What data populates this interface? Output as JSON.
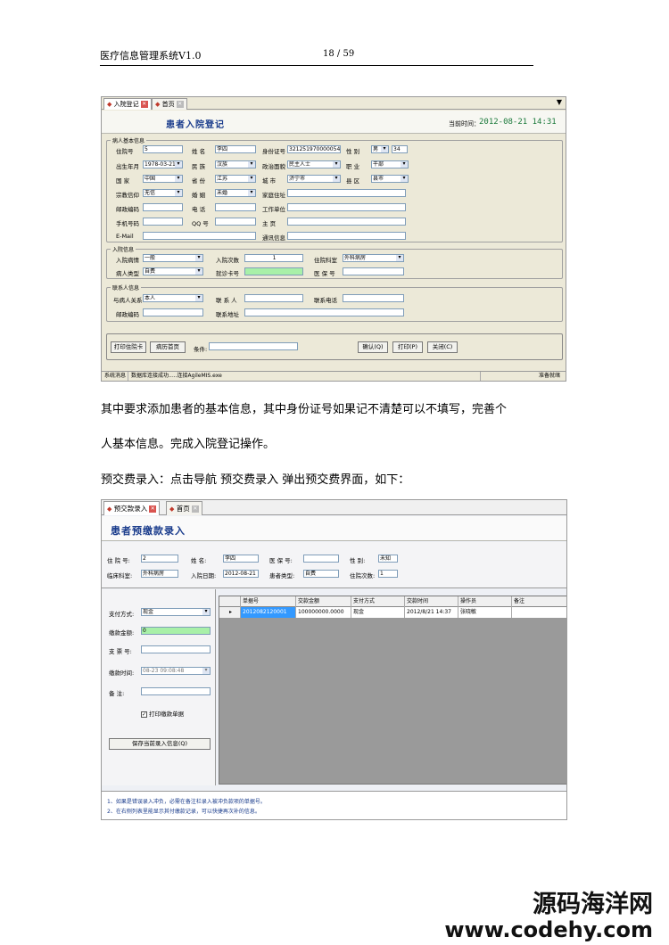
{
  "header": {
    "title": "医疗信息管理系统V1.0",
    "page": "18 / 59"
  },
  "shot1": {
    "tabs": [
      "入院登记",
      "首页"
    ],
    "form_title": "患者入院登记",
    "time_label": "当前时间：",
    "time_value": "2012-08-21 14:31",
    "group_basic": "病人基本信息",
    "fields": {
      "inpatient_no_label": "住院号",
      "inpatient_no": "5",
      "name_label": "姓 名",
      "name": "李四",
      "id_label": "身份证号",
      "id": "3212519700000542",
      "gender_label": "性 别",
      "gender": "男",
      "age": "34",
      "birth_label": "出生年月",
      "birth": "1978-03-21",
      "nation_label": "民 族",
      "nation": "汉族",
      "politics_label": "政治面貌",
      "politics": "民主人士",
      "job_label": "职 业",
      "job": "干部",
      "country_label": "国 家",
      "country": "中国",
      "province_label": "省 份",
      "province": "江苏",
      "city_label": "城 市",
      "city": "济宁市",
      "district_label": "县 区",
      "district": "县市",
      "religion_label": "宗教信仰",
      "religion": "无信",
      "marriage_label": "婚 姻",
      "marriage": "未婚",
      "address_label": "家庭住址",
      "zip_label": "邮政编码",
      "phone_label": "电 话",
      "work_label": "工作单位",
      "mobile_label": "手机号码",
      "qq_label": "QQ 号",
      "homepage_label": "主 页",
      "email_label": "E-Mail",
      "contact_label": "通讯信息"
    },
    "group_admission": "入院信息",
    "admission": {
      "condition_label": "入院病情",
      "condition": "一般",
      "times_label": "入院次数",
      "times": "1",
      "dept_label": "住院科室",
      "dept": "外科病房",
      "type_label": "病人类型",
      "type": "自费",
      "card_label": "就诊卡号",
      "insurance_label": "医 保 号"
    },
    "group_contact": "联系人信息",
    "contact": {
      "relation_label": "与病人关系",
      "relation": "本人",
      "person_label": "联 系 人",
      "phone_label": "联系电话",
      "zip_label": "邮政编码",
      "address_label": "联系地址"
    },
    "buttons": {
      "print_card": "打印住院卡",
      "print_first": "病历首页",
      "receipt_label": "条件:",
      "ok": "确认(Q)",
      "print": "打印(P)",
      "close": "关闭(C)"
    },
    "status": {
      "cell1": "系统消息",
      "cell2": "数据库连接成功.....连接AgileMIS.exe",
      "cell3": "准备就绪"
    }
  },
  "paragraphs": {
    "p1": "其中要求添加患者的基本信息，其中身份证号如果记不清楚可以不填写，完善个",
    "p2": "人基本信息。完成入院登记操作。",
    "p3": "预交费录入：点击导航 预交费录入 弹出预交费界面，如下："
  },
  "shot2": {
    "tabs": [
      "预交款录入",
      "首页"
    ],
    "form_title": "患者预缴款录入",
    "info": {
      "inpatient_no_label": "住 院 号:",
      "inpatient_no": "2",
      "name_label": "姓 名:",
      "name": "李四",
      "insurance_label": "医 保 号:",
      "gender_label": "性 别:",
      "gender": "未知",
      "dept_label": "临床科室:",
      "dept": "外科病房",
      "date_label": "入院日期:",
      "date": "2012-08-21",
      "ptype_label": "患者类型:",
      "ptype": "自费",
      "times_label": "住院次数:",
      "times": "1"
    },
    "left": {
      "pay_method_label": "支付方式:",
      "pay_method": "现金",
      "amount_label": "缴款金额:",
      "amount": "0",
      "voucher_label": "支 票 号:",
      "time_label": "缴款时间:",
      "time": "08-23 09:08:48",
      "remark_label": "备 注:",
      "print_label": "打印缴款单据",
      "save_button": "保存当前录入信息(Q)"
    },
    "grid": {
      "columns": [
        "单据号",
        "交款金额",
        "支付方式",
        "交款时间",
        "操作员",
        "备注"
      ],
      "rows": [
        [
          "2012082120001",
          "100000000.0000",
          "现金",
          "2012/8/21 14:37",
          "张晓敏",
          ""
        ]
      ]
    },
    "notes": [
      "1、如果是错误录入冲负，必需在备注栏录入被冲负款项的单据号。",
      "2、在右侧列表里能显示其付缴款记录，可以快捷再次补的信息。"
    ]
  },
  "watermark": {
    "cn": "源码海洋网",
    "url": "www.codehy.com"
  }
}
